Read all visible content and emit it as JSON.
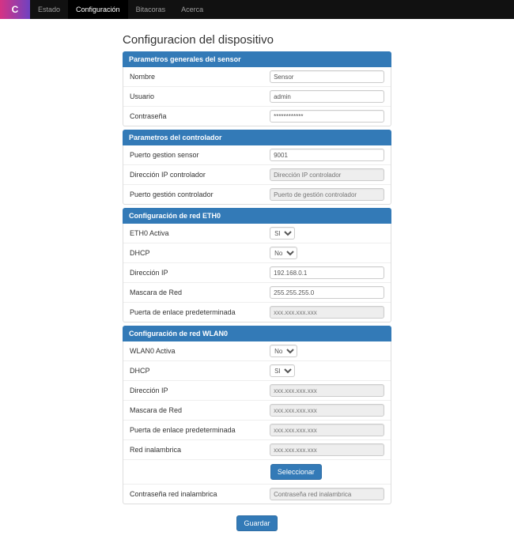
{
  "nav": {
    "items": [
      {
        "label": "Estado",
        "active": false
      },
      {
        "label": "Configuración",
        "active": true
      },
      {
        "label": "Bitacoras",
        "active": false
      },
      {
        "label": "Acerca",
        "active": false
      }
    ]
  },
  "page": {
    "title": "Configuracion del dispositivo"
  },
  "panel1": {
    "heading": "Parametros generales del sensor",
    "nombre_label": "Nombre",
    "nombre_value": "Sensor",
    "usuario_label": "Usuario",
    "usuario_value": "admin",
    "contrasena_label": "Contraseña",
    "contrasena_value": "************"
  },
  "panel2": {
    "heading": "Parametros del controlador",
    "puerto_sensor_label": "Puerto gestion sensor",
    "puerto_sensor_value": "9001",
    "ip_ctrl_label": "Dirección IP controlador",
    "ip_ctrl_placeholder": "Dirección IP controlador",
    "puerto_ctrl_label": "Puerto gestión controlador",
    "puerto_ctrl_placeholder": "Puerto de gestión controlador"
  },
  "panel3": {
    "heading": "Configuración de red ETH0",
    "activa_label": "ETH0 Activa",
    "activa_value": "SI",
    "dhcp_label": "DHCP",
    "dhcp_value": "No",
    "ip_label": "Dirección IP",
    "ip_value": "192.168.0.1",
    "mask_label": "Mascara de Red",
    "mask_value": "255.255.255.0",
    "gw_label": "Puerta de enlace predeterminada",
    "gw_placeholder": "xxx.xxx.xxx.xxx"
  },
  "panel4": {
    "heading": "Configuración de red WLAN0",
    "activa_label": "WLAN0 Activa",
    "activa_value": "No",
    "dhcp_label": "DHCP",
    "dhcp_value": "SI",
    "ip_label": "Dirección IP",
    "ip_placeholder": "xxx.xxx.xxx.xxx",
    "mask_label": "Mascara de Red",
    "mask_placeholder": "xxx.xxx.xxx.xxx",
    "gw_label": "Puerta de enlace predeterminada",
    "gw_placeholder": "xxx.xxx.xxx.xxx",
    "ssid_label": "Red inalambrica",
    "ssid_placeholder": "xxx.xxx.xxx.xxx",
    "select_btn": "Seleccionar",
    "pass_label": "Contraseña red inalambrica",
    "pass_placeholder": "Contraseña red inalambrica"
  },
  "footer": {
    "save": "Guardar"
  },
  "options": {
    "sino": [
      "SI",
      "No"
    ]
  }
}
